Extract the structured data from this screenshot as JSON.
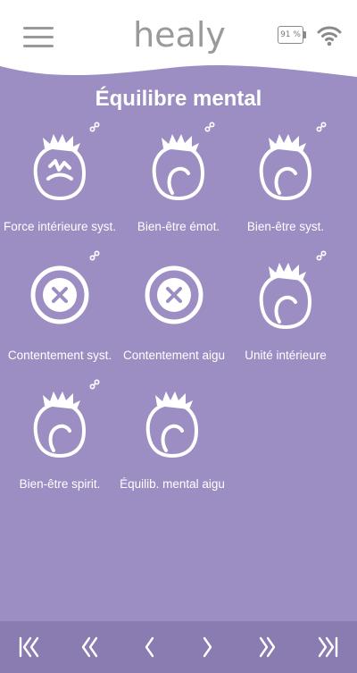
{
  "header": {
    "logo": "healy",
    "battery": "91 %",
    "icons": {
      "menu": "hamburger-menu-icon",
      "wifi": "wifi-icon"
    }
  },
  "page": {
    "title": "Équilibre mental"
  },
  "programs": [
    {
      "label": "Force intérieure syst.",
      "icon": "head-broken-icon",
      "linked": true
    },
    {
      "label": "Bien-être émot.",
      "icon": "head-icon",
      "linked": true
    },
    {
      "label": "Bien-être syst.",
      "icon": "head-icon",
      "linked": true
    },
    {
      "label": "Contentement syst.",
      "icon": "x-circle-icon",
      "linked": true
    },
    {
      "label": "Contentement aigu",
      "icon": "x-circle-icon",
      "linked": false
    },
    {
      "label": "Unité intérieure",
      "icon": "head-icon",
      "linked": true
    },
    {
      "label": "Bien-être spirit.",
      "icon": "head-icon",
      "linked": true
    },
    {
      "label": "Équilib. mental aigu",
      "icon": "head-icon",
      "linked": false
    }
  ],
  "footer": {
    "buttons": [
      "first-page",
      "previous-block",
      "previous",
      "next",
      "next-block",
      "last-page"
    ]
  },
  "colors": {
    "background": "#9c8ec2",
    "footer": "#8a7bb0",
    "header": "#ffffff",
    "logo": "#9a9a9a"
  }
}
